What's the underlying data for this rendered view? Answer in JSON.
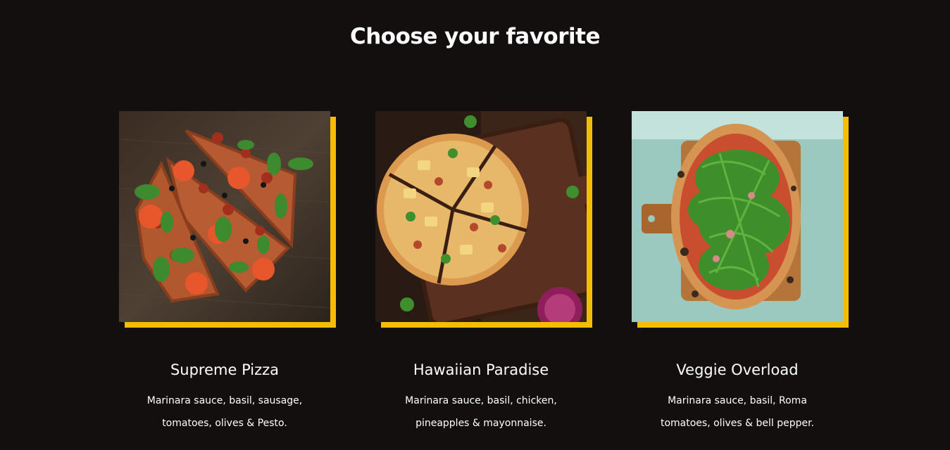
{
  "section": {
    "heading": "Choose your favorite"
  },
  "colors": {
    "background": "#130f0f",
    "accent": "#f5bd02",
    "text": "#ffffff"
  },
  "cards": [
    {
      "title": "Supreme Pizza",
      "description": "Marinara sauce, basil, sausage, tomatoes, olives & Pesto.",
      "image": "supreme-pizza-photo"
    },
    {
      "title": "Hawaiian Paradise",
      "description": "Marinara sauce, basil, chicken, pineapples & mayonnaise.",
      "image": "hawaiian-pizza-photo"
    },
    {
      "title": "Veggie Overload",
      "description": "Marinara sauce, basil, Roma tomatoes, olives & bell pepper.",
      "image": "veggie-pizza-photo"
    }
  ]
}
